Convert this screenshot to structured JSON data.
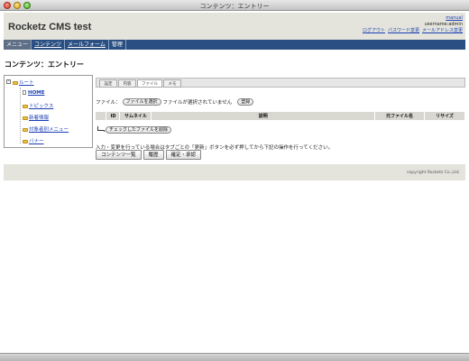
{
  "window": {
    "title": "コンテンツ：エントリー"
  },
  "header": {
    "app_title": "Rocketz CMS test",
    "manual_link": "manual",
    "username": "username:admin",
    "links": [
      "ログアウト",
      "パスワード変更",
      "メールアドレス変更"
    ]
  },
  "nav": {
    "items": [
      "メニュー",
      "コンテンツ",
      "メールフォーム",
      "管理"
    ]
  },
  "page": {
    "title": "コンテンツ：エントリー"
  },
  "tree": {
    "root": "ルート",
    "items": [
      "HOME",
      "トピックス",
      "新着情報",
      "対象者別メニュー",
      "バナー"
    ]
  },
  "tabs": [
    "設定",
    "内容",
    "ファイル",
    "メモ"
  ],
  "file_form": {
    "label": "ファイル：",
    "choose_button": "ファイルを選択",
    "no_file_text": "ファイルが選択されていません",
    "register_button": "登録"
  },
  "file_table": {
    "columns": [
      "ID",
      "サムネイル",
      "説明",
      "元ファイル名",
      "リサイズ"
    ]
  },
  "delete_button": "チェックしたファイルを削除",
  "notice": "入力・変更を行っている場合はタブごとの「更新」ボタンを必ず押してから下記の操作を行ってください。",
  "bottom_buttons": [
    "コンテンツ一覧",
    "履歴",
    "確定・承認"
  ],
  "footer": {
    "copyright": "copyright Rocketz Co.,Ltd."
  }
}
